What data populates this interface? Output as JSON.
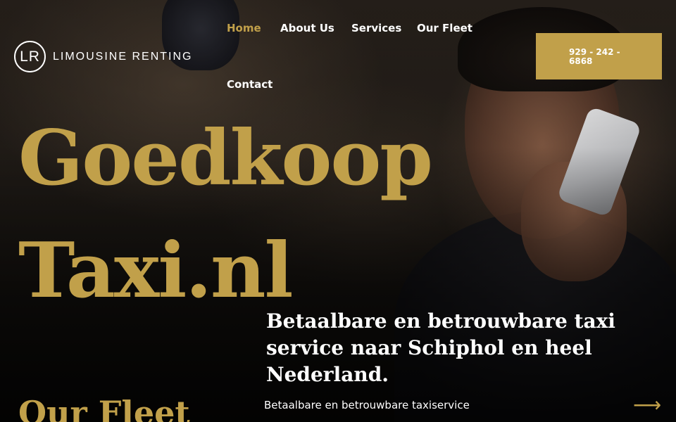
{
  "brand": {
    "badge": "LR",
    "name": "LIMOUSINE RENTING"
  },
  "nav": {
    "items": [
      {
        "label": "Home",
        "active": true
      },
      {
        "label": "About Us"
      },
      {
        "label": "Services"
      },
      {
        "label": "Our Fleet"
      },
      {
        "label": "Contact"
      }
    ]
  },
  "cta": {
    "phone": "929 - 242 - 6868"
  },
  "hero": {
    "title_line1": "Goedkoop",
    "title_line2": "Taxi.nl",
    "subtitle": "Betaalbare en betrouwbare taxi service naar Schiphol en heel Nederland.",
    "lead": "Betaalbare en betrouwbare taxiservice",
    "arrow_icon": "arrow-right-icon"
  },
  "fleet": {
    "heading": "Our Fleet"
  },
  "colors": {
    "accent": "#c1a04a",
    "text": "#ffffff",
    "background": "#1a1613"
  }
}
